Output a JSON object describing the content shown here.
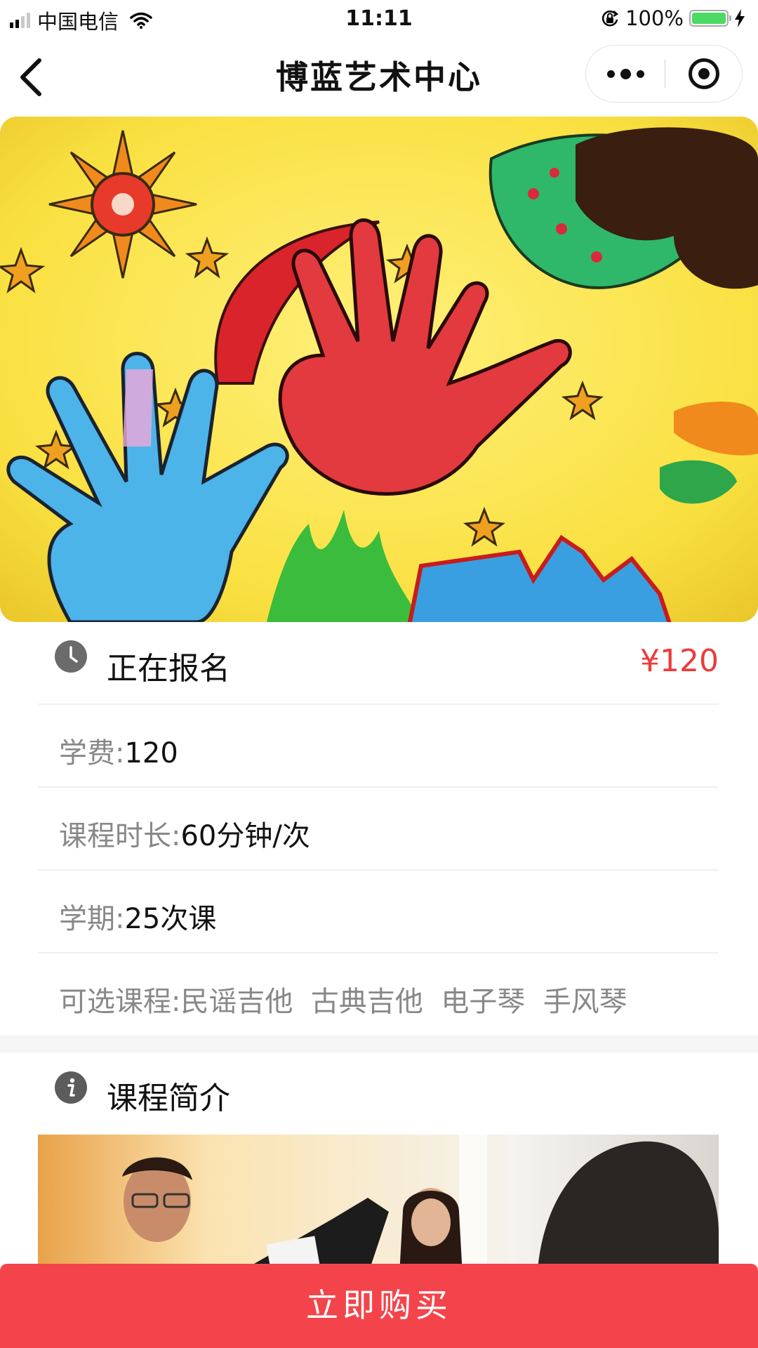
{
  "status_bar": {
    "carrier": "中国电信",
    "time": "11:11",
    "battery": "100%",
    "battery_level": 1.0,
    "signal_bars_filled": 2,
    "signal_bars_total": 4
  },
  "nav": {
    "title": "博蓝艺术中心"
  },
  "course": {
    "status": "正在报名",
    "price": "¥120",
    "fields": [
      {
        "label": "学费:",
        "value": "120"
      },
      {
        "label": "课程时长:",
        "value": "60分钟/次"
      },
      {
        "label": "学期:",
        "value": "25次课"
      },
      {
        "label": "可选课程:",
        "value": "民谣吉他  古典吉他  电子琴  手风琴"
      }
    ]
  },
  "intro": {
    "title": "课程简介"
  },
  "actions": {
    "buy_label": "立即购买"
  },
  "colors": {
    "price": "#ee3b3b",
    "buy_button": "#f4444b",
    "battery": "#4cd964"
  },
  "icons": [
    "back-arrow-icon",
    "more-dots-icon",
    "close-target-icon",
    "clock-icon",
    "info-icon",
    "wifi-icon",
    "lock-rotation-icon",
    "charging-icon"
  ]
}
